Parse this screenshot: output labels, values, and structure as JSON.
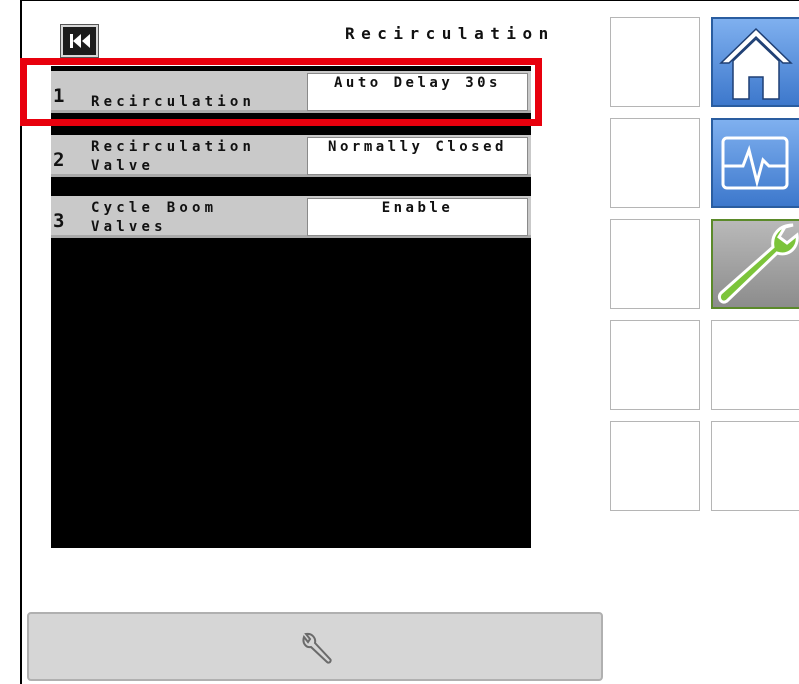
{
  "header": {
    "title": "Recirculation",
    "back_icon": "skip-back-icon"
  },
  "settings": [
    {
      "number": "1",
      "label": "Recirculation",
      "value": "Auto Delay 30s",
      "highlighted": true
    },
    {
      "number": "2",
      "label": "Recirculation\nValve",
      "value": "Normally Closed",
      "highlighted": false
    },
    {
      "number": "3",
      "label": "Cycle Boom\nValves",
      "value": "Enable",
      "highlighted": false
    }
  ],
  "side_icons": {
    "home": "home-icon",
    "diagnostics": "pulse-icon",
    "tools": "wrench-icon"
  },
  "bottom_bar": {
    "icon": "wrench-icon"
  },
  "colors": {
    "highlight": "#e8000d",
    "panel": "#000000",
    "row": "#c9c9c9",
    "home_blue": "#4a86d8",
    "tool_green": "#6ab42c"
  }
}
